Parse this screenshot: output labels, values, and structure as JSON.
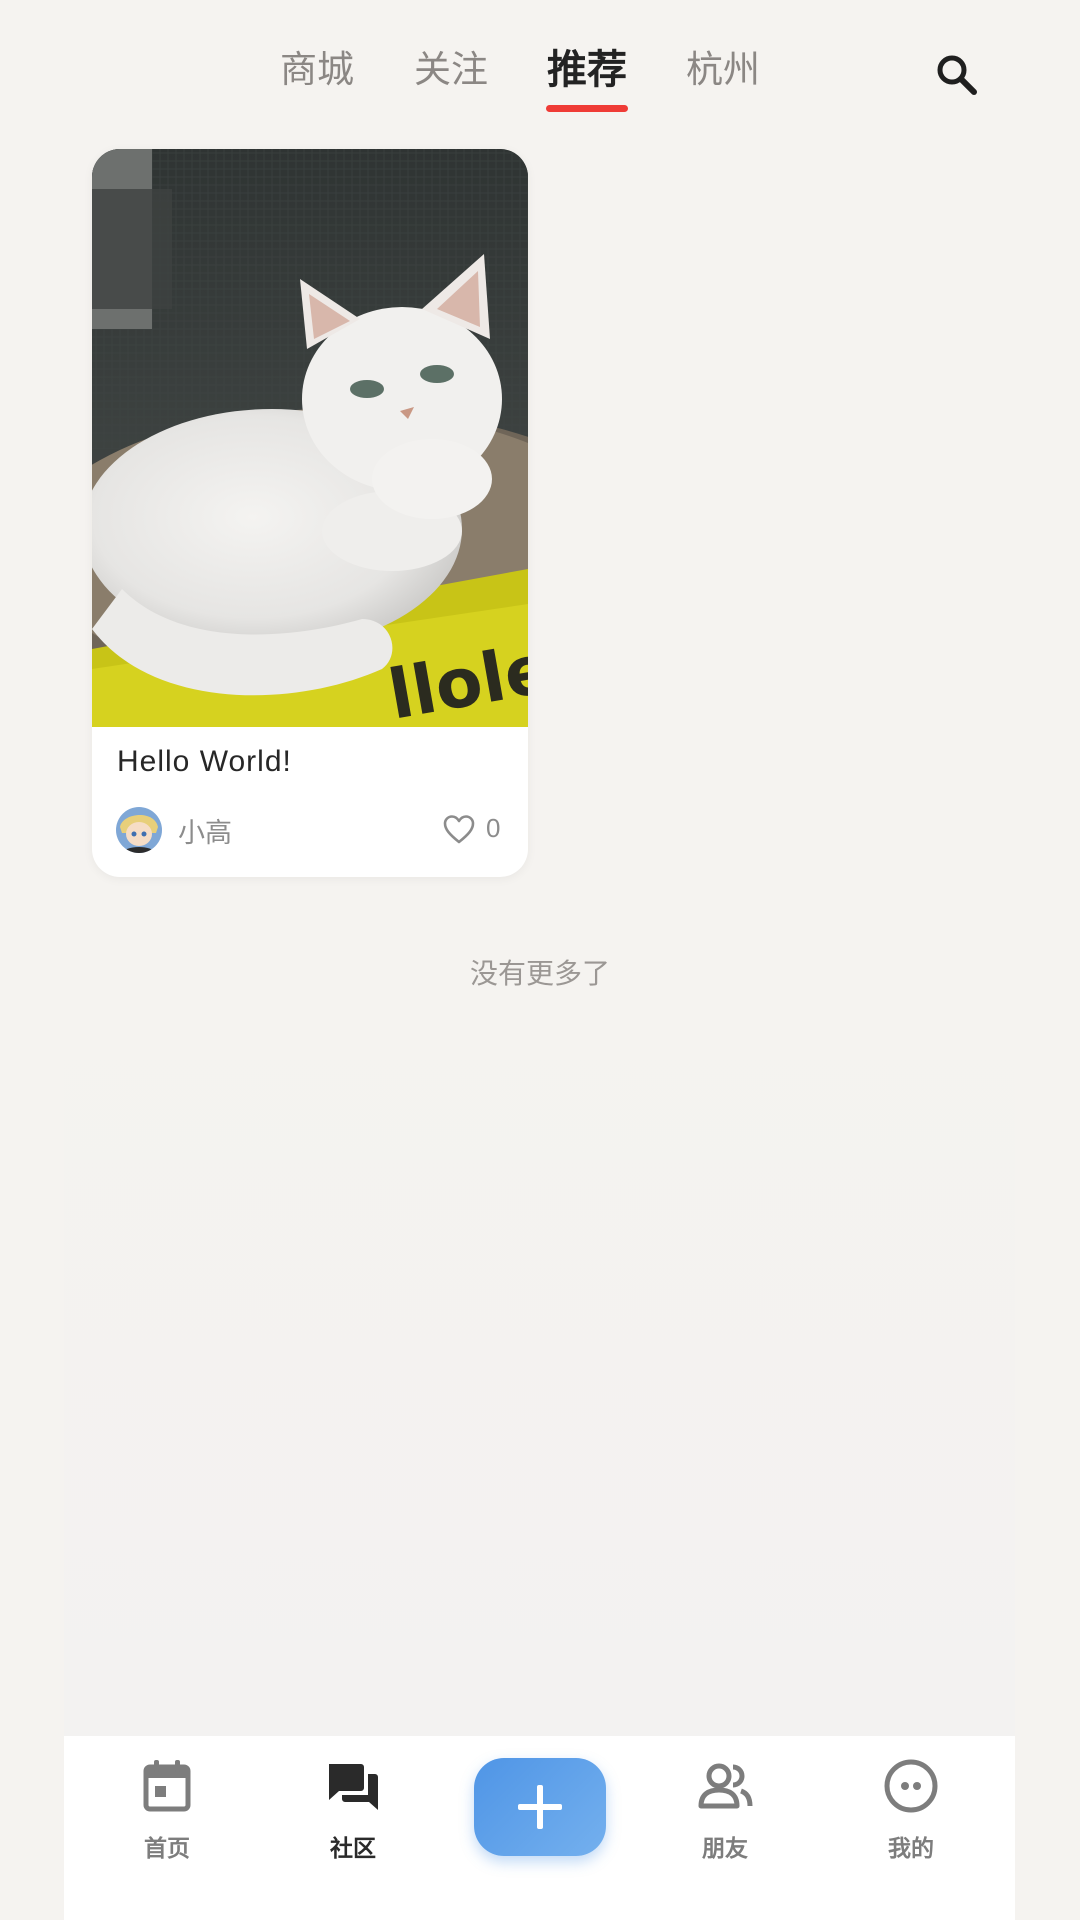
{
  "top_tabs": [
    {
      "label": "商城",
      "active": false
    },
    {
      "label": "关注",
      "active": false
    },
    {
      "label": "推荐",
      "active": true
    },
    {
      "label": "杭州",
      "active": false
    }
  ],
  "search": {
    "icon": "search-icon"
  },
  "post": {
    "title": "Hello World!",
    "author": "小高",
    "likes": "0",
    "image": "white-cat-on-cardboard-scratcher",
    "like_icon": "heart-outline-icon"
  },
  "feed_end_text": "没有更多了",
  "bottom_nav": {
    "items": [
      {
        "label": "首页",
        "icon": "calendar-icon",
        "active": false
      },
      {
        "label": "社区",
        "icon": "chat-bubbles-icon",
        "active": true
      },
      {
        "label": "朋友",
        "icon": "people-icon",
        "active": false
      },
      {
        "label": "我的",
        "icon": "face-circle-icon",
        "active": false
      }
    ],
    "add_button_icon": "plus-icon"
  },
  "colors": {
    "accent_underline": "#ef3b36",
    "fab_blue": "#5b9eea",
    "background": "#f5f3f0",
    "active_text": "#232323",
    "inactive_text": "#8b8784"
  }
}
